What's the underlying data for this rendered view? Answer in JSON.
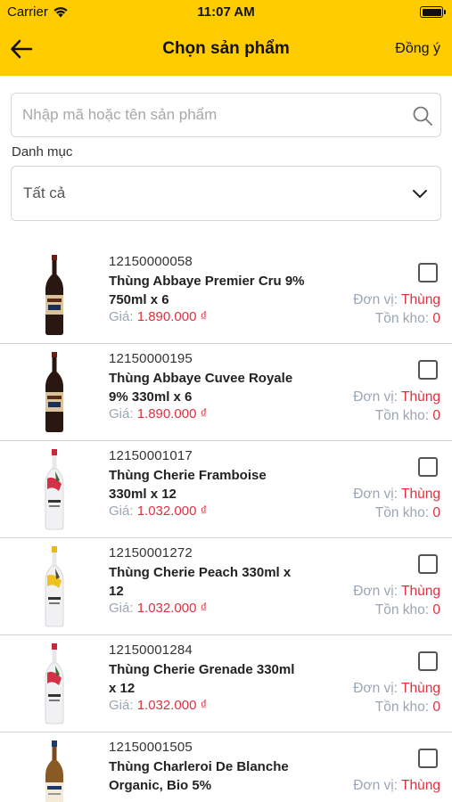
{
  "status_bar": {
    "carrier": "Carrier",
    "time": "11:07 AM"
  },
  "header": {
    "title": "Chọn sản phẩm",
    "confirm_label": "Đồng ý"
  },
  "search": {
    "placeholder": "Nhập mã hoặc tên sản phẩm",
    "value": ""
  },
  "category": {
    "label": "Danh mục",
    "selected": "Tất cả"
  },
  "labels": {
    "price": "Giá:",
    "unit": "Đơn vị:",
    "stock": "Tồn kho:"
  },
  "colors": {
    "header_bg": "#ffcc00",
    "price": "#e0303f",
    "muted": "#9aa6b5"
  },
  "products": [
    {
      "code": "12150000058",
      "name": "Thùng Abbaye Premier Cru 9% 750ml x 6",
      "price": "1.890.000 ₫",
      "unit": "Thùng",
      "stock": "0",
      "checked": false,
      "bottle": "dark"
    },
    {
      "code": "12150000195",
      "name": "Thùng Abbaye Cuvee Royale 9% 330ml x 6",
      "price": "1.890.000 ₫",
      "unit": "Thùng",
      "stock": "0",
      "checked": false,
      "bottle": "dark"
    },
    {
      "code": "12150001017",
      "name": "Thùng Cherie Framboise 330ml x 12",
      "price": "1.032.000 ₫",
      "unit": "Thùng",
      "stock": "0",
      "checked": false,
      "bottle": "white-red"
    },
    {
      "code": "12150001272",
      "name": "Thùng Cherie Peach 330ml x 12",
      "price": "1.032.000 ₫",
      "unit": "Thùng",
      "stock": "0",
      "checked": false,
      "bottle": "white-yellow"
    },
    {
      "code": "12150001284",
      "name": "Thùng Cherie Grenade 330ml x 12",
      "price": "1.032.000 ₫",
      "unit": "Thùng",
      "stock": "0",
      "checked": false,
      "bottle": "white-red"
    },
    {
      "code": "12150001505",
      "name": "Thùng Charleroi De Blanche Organic, Bio 5%",
      "price": "",
      "unit": "Thùng",
      "stock": "",
      "checked": false,
      "bottle": "amber"
    }
  ]
}
